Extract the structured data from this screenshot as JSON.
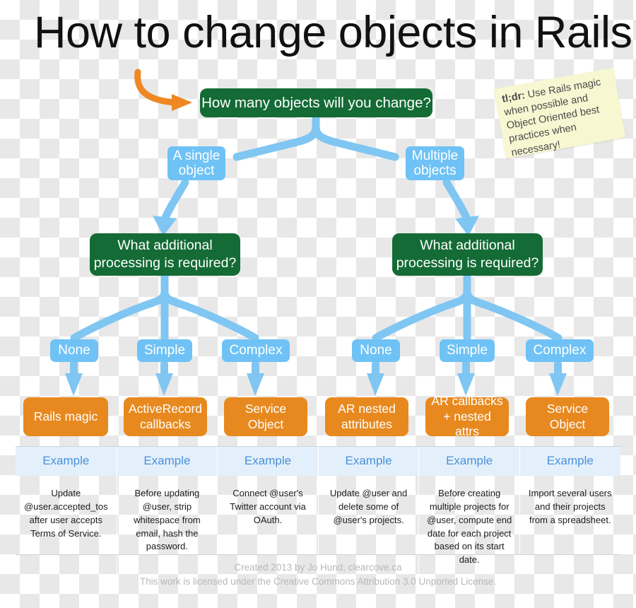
{
  "title": "How to change objects in Rails",
  "colors": {
    "green": "#146b35",
    "orange": "#e7891f",
    "blue": "#6fc2f5",
    "example_header_bg": "#e3f0fb",
    "example_header_text": "#4a90d9",
    "note_bg": "#f7f7d2",
    "arrow_orange": "#ef8722"
  },
  "root_question": "How many objects will you change?",
  "branches": {
    "left_label": "A single\nobject",
    "left_label_line1": "A single",
    "left_label_line2": "object",
    "right_label_line1": "Multiple",
    "right_label_line2": "objects"
  },
  "sub_question": {
    "line1": "What additional",
    "line2": "processing is required?"
  },
  "processing_labels": {
    "none": "None",
    "simple": "Simple",
    "complex": "Complex"
  },
  "results": [
    {
      "line1": "Rails magic",
      "line2": ""
    },
    {
      "line1": "ActiveRecord",
      "line2": "callbacks"
    },
    {
      "line1": "Service",
      "line2": "Object"
    },
    {
      "line1": "AR nested",
      "line2": "attributes"
    },
    {
      "line1": "AR callbacks",
      "line2": "+ nested attrs"
    },
    {
      "line1": "Service",
      "line2": "Object"
    }
  ],
  "example_header": "Example",
  "examples": [
    "Update @user.accepted_tos after user accepts Terms of Service.",
    "Before updating @user, strip whitespace from email, hash the password.",
    "Connect @user's Twitter account via OAuth.",
    "Update @user and delete some of @user's projects.",
    "Before creating multiple projects for @user, compute end date for each project based on its start date.",
    "Import several users and their projects from a spreadsheet."
  ],
  "note": {
    "prefix": "tl;dr:",
    "text": " Use Rails magic when possible and Object Oriented best practices when necessary!"
  },
  "footer": {
    "line1": "Created 2013 by Jo Hund, clearcove.ca",
    "line2": "This work is licensed under the Creative Commons Attribution 3.0 Unported License."
  }
}
